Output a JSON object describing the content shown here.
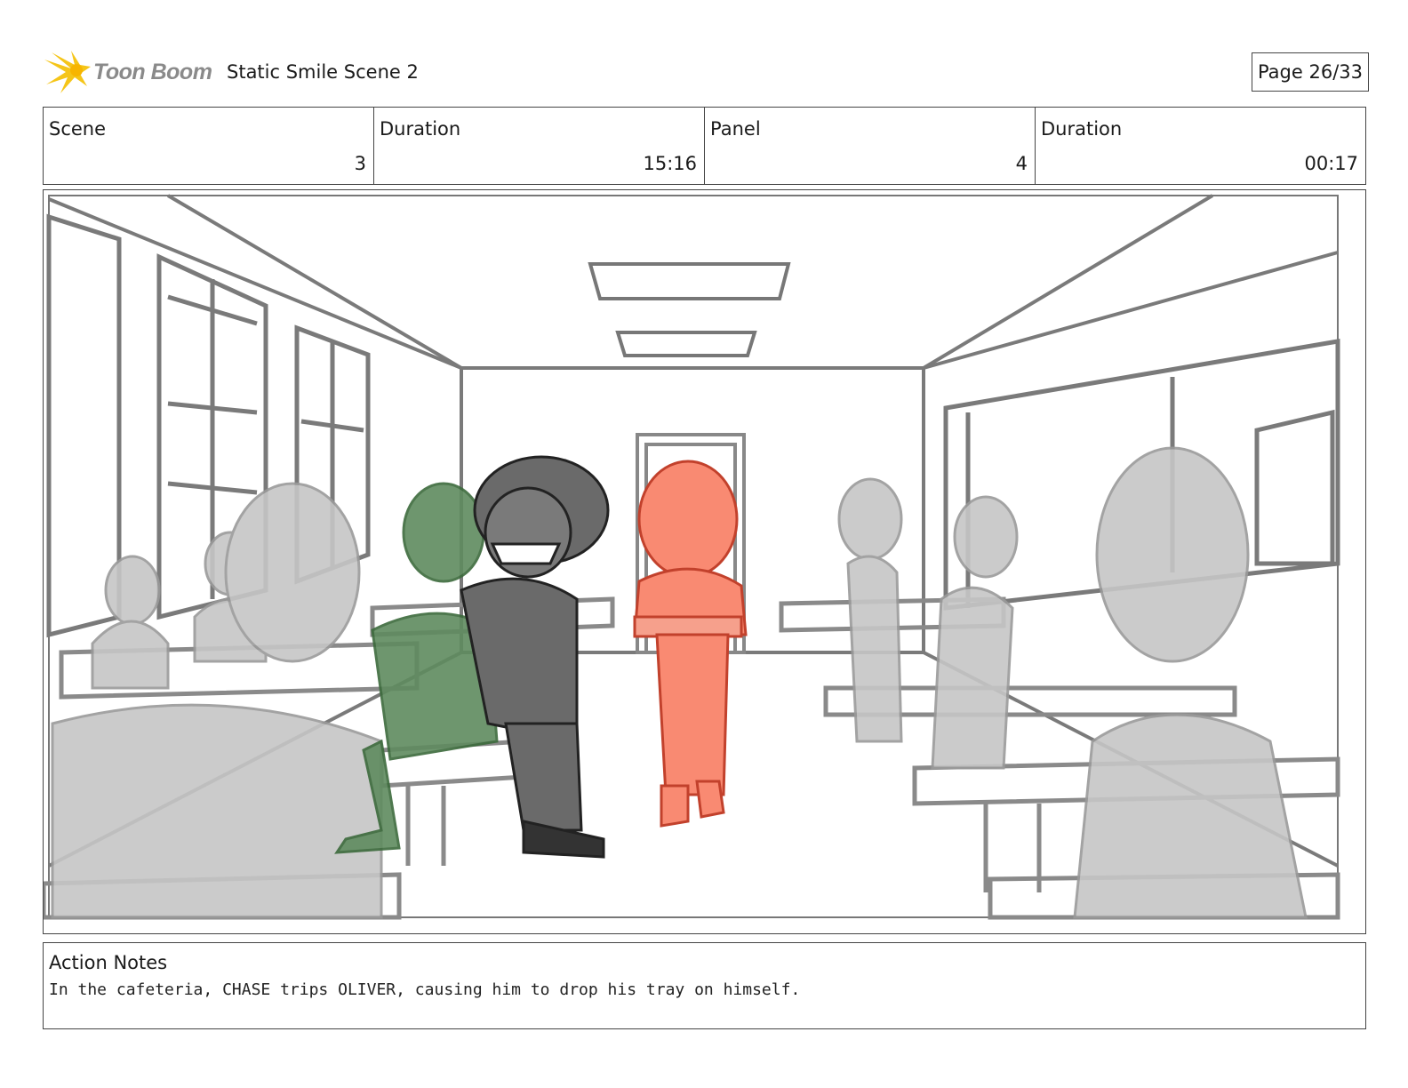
{
  "header": {
    "logo_text": "Toon Boom",
    "title": "Static Smile Scene 2",
    "page": "Page 26/33"
  },
  "info": [
    {
      "label": "Scene",
      "value": "3"
    },
    {
      "label": "Duration",
      "value": "15:16"
    },
    {
      "label": "Panel",
      "value": "4"
    },
    {
      "label": "Duration",
      "value": "00:17"
    }
  ],
  "panel": {
    "colors": {
      "line": "#6e6e6e",
      "bg_character": "#bdbdbd",
      "green_character": "#5e8a5e",
      "chase": "#6a6a6a",
      "oliver": "#f98a72"
    }
  },
  "notes": {
    "label": "Action Notes",
    "text": "In the cafeteria, CHASE trips OLIVER, causing him to drop his tray on himself."
  }
}
